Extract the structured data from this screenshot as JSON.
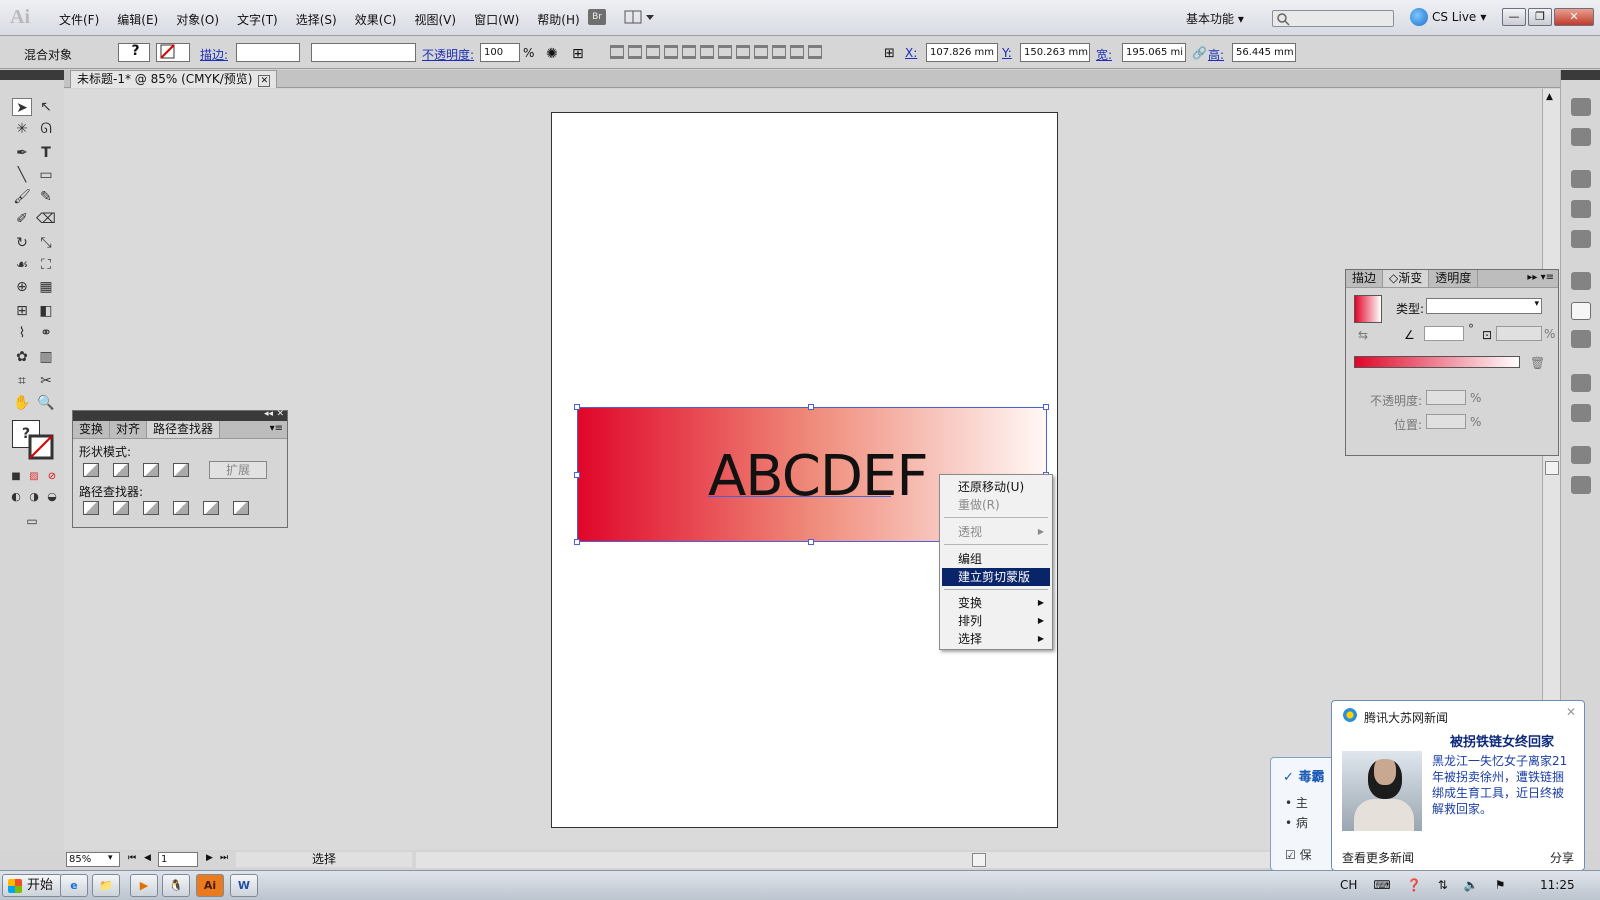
{
  "app": {
    "logo": "Ai",
    "menus": [
      "文件(F)",
      "编辑(E)",
      "对象(O)",
      "文字(T)",
      "选择(S)",
      "效果(C)",
      "视图(V)",
      "窗口(W)",
      "帮助(H)"
    ],
    "bridge_label": "Br",
    "workspace": "基本功能",
    "cs_live": "CS Live",
    "window_buttons": {
      "minimize": "—",
      "restore": "❐",
      "close": "✕"
    }
  },
  "control_bar": {
    "object_type": "混合对象",
    "fill_symbol": "?",
    "stroke_label": "描边:",
    "opacity_label": "不透明度:",
    "opacity_value": "100",
    "opacity_unit": "%",
    "x_label": "X:",
    "x_value": "107.826 mm",
    "y_label": "Y:",
    "y_value": "150.263 mm",
    "w_label": "宽:",
    "w_value": "195.065 mi",
    "h_label": "高:",
    "h_value": "56.445 mm"
  },
  "document": {
    "tab_title": "未标题-1* @ 85% (CMYK/预览)",
    "tab_close": "✕",
    "text_object": "ABCDEF",
    "zoom": "85%",
    "page": "1",
    "status": "选择"
  },
  "pathfinder_panel": {
    "tabs": [
      "变换",
      "对齐",
      "路径查找器"
    ],
    "active_tab": 2,
    "shape_modes_label": "形状模式:",
    "pathfinders_label": "路径查找器:",
    "expand_label": "扩展"
  },
  "gradient_panel": {
    "tabs": [
      "描边",
      "◇渐变",
      "透明度"
    ],
    "active_tab": 1,
    "type_label": "类型:",
    "degree": "°",
    "percent": "%",
    "opacity_label": "不透明度:",
    "position_label": "位置:",
    "gradient_start_color": "#e0062a",
    "gradient_end_color": "#ffffff"
  },
  "context_menu": {
    "items": [
      {
        "label": "还原移动(U)",
        "disabled": false,
        "submenu": false
      },
      {
        "label": "重做(R)",
        "disabled": true,
        "submenu": false
      },
      {
        "label": "透视",
        "disabled": true,
        "submenu": true
      },
      {
        "label": "编组",
        "disabled": false,
        "submenu": false
      },
      {
        "label": "建立剪切蒙版",
        "disabled": false,
        "submenu": false,
        "highlighted": true
      },
      {
        "label": "变换",
        "disabled": false,
        "submenu": true
      },
      {
        "label": "排列",
        "disabled": false,
        "submenu": true
      },
      {
        "label": "选择",
        "disabled": false,
        "submenu": true
      }
    ]
  },
  "popup_virus": {
    "title": "毒霸",
    "bullets": [
      "主",
      "病"
    ],
    "checkbox_label": "保"
  },
  "news_popup": {
    "source": "腾讯大苏网新闻",
    "close": "✕",
    "headline": "被拐铁链女终回家",
    "body": "黑龙江一失忆女子离家21年被拐卖徐州，遭铁链捆绑成生育工具，近日终被解救回家。",
    "more_link": "查看更多新闻",
    "share": "分享"
  },
  "taskbar": {
    "start": "开始",
    "apps": [
      "e",
      "📁",
      "▶",
      "🐧",
      "Ai",
      "W"
    ],
    "tray": [
      "CH"
    ],
    "clock": "11:25"
  },
  "colors": {
    "selection_blue": "#4a62d9",
    "menu_highlight": "#0a246a",
    "link_blue": "#1c2fb6"
  }
}
